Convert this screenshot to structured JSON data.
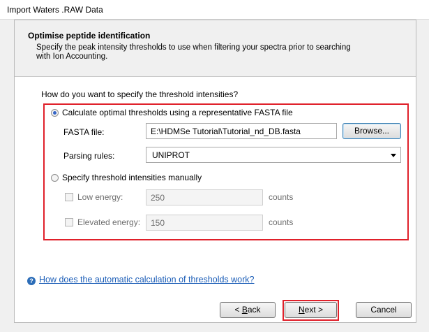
{
  "window": {
    "title": "Import Waters .RAW Data"
  },
  "header": {
    "title": "Optimise peptide identification",
    "description": "Specify the peak intensity thresholds to use when filtering your spectra prior to searching with Ion Accounting."
  },
  "question": "How do you want to specify the threshold intensities?",
  "option_fasta": {
    "label": "Calculate optimal thresholds using a representative FASTA file",
    "selected": true,
    "fasta_label": "FASTA file:",
    "fasta_value": "E:\\HDMSe Tutorial\\Tutorial_nd_DB.fasta",
    "browse_label": "Browse...",
    "parsing_label": "Parsing rules:",
    "parsing_value": "UNIPROT"
  },
  "option_manual": {
    "label": "Specify threshold intensities manually",
    "selected": false,
    "low_label": "Low energy:",
    "low_value": "250",
    "low_unit": "counts",
    "elevated_label": "Elevated energy:",
    "elevated_value": "150",
    "elevated_unit": "counts"
  },
  "help_link": "How does the automatic calculation of thresholds work?",
  "buttons": {
    "back_prefix": "< ",
    "back_key": "B",
    "back_rest": "ack",
    "next_key": "N",
    "next_rest": "ext >",
    "cancel": "Cancel"
  },
  "colors": {
    "highlight": "#e0202a",
    "link": "#1b5db7",
    "radio_dot": "#3565c6"
  }
}
